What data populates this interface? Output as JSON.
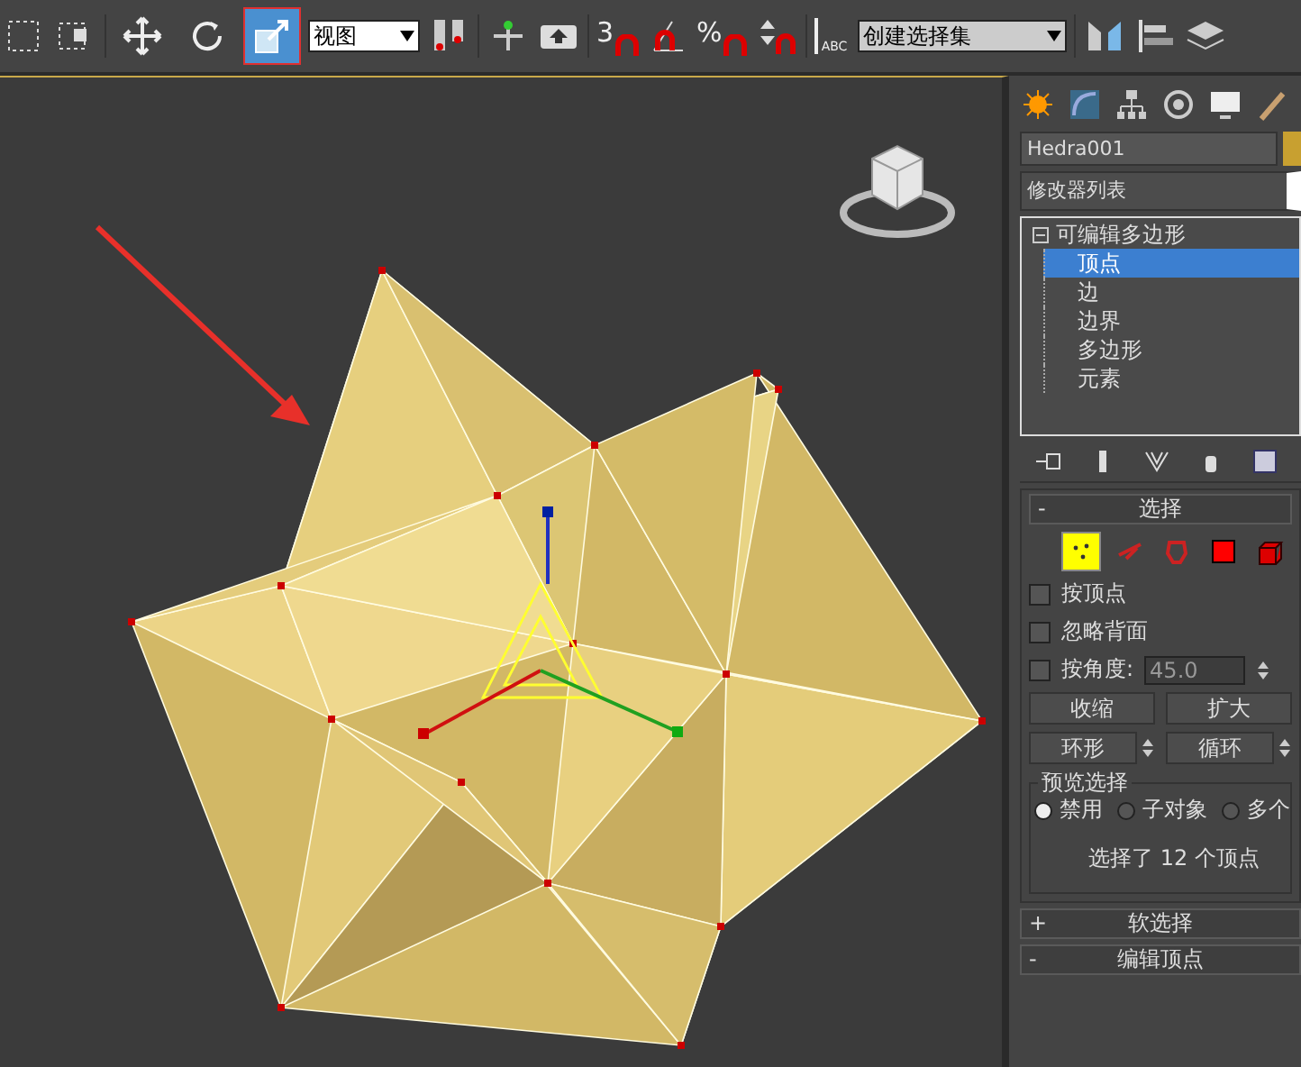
{
  "toolbar": {
    "transform_tools": [
      {
        "selected": false
      },
      {
        "selected": false
      },
      {
        "selected": true
      }
    ],
    "view_dropdown": "视图",
    "snap_labels": [
      "3",
      "%"
    ],
    "edit_named_label": "ABC",
    "selection_set_dropdown": "创建选择集"
  },
  "command_panel": {
    "object_name": "Hedra001",
    "modifier_list": "修改器列表",
    "stack": [
      {
        "label": "可编辑多边形",
        "expanded": true,
        "selected": false,
        "children": [
          {
            "label": "顶点",
            "selected": true
          },
          {
            "label": "边",
            "selected": false
          },
          {
            "label": "边界",
            "selected": false
          },
          {
            "label": "多边形",
            "selected": false
          },
          {
            "label": "元素",
            "selected": false
          }
        ]
      }
    ],
    "selection_rollout": {
      "sign": "-",
      "title": "选择",
      "subobject_levels": [
        {
          "kind": "vertex",
          "selected": true
        },
        {
          "kind": "edge",
          "selected": false
        },
        {
          "kind": "border",
          "selected": false
        },
        {
          "kind": "polygon",
          "selected": false
        },
        {
          "kind": "element",
          "selected": false
        }
      ],
      "checkboxes": [
        {
          "label": "按顶点",
          "checked": false
        },
        {
          "label": "忽略背面",
          "checked": false
        },
        {
          "label": "按角度:",
          "checked": false
        }
      ],
      "angle_value": "45.0",
      "button_rows": [
        [
          {
            "label": "收缩",
            "spinner": false
          },
          {
            "label": "扩大",
            "spinner": false
          }
        ],
        [
          {
            "label": "环形",
            "spinner": true
          },
          {
            "label": "循环",
            "spinner": true
          }
        ]
      ],
      "preview_group": "预览选择",
      "preview_options": [
        {
          "label": "禁用",
          "selected": true
        },
        {
          "label": "子对象",
          "selected": false
        },
        {
          "label": "多个",
          "selected": false
        }
      ],
      "status": "选择了 12 个顶点"
    },
    "collapsed_rollouts": [
      {
        "sign": "+",
        "title": "软选择"
      },
      {
        "sign": "-",
        "title": "编辑顶点"
      }
    ]
  }
}
